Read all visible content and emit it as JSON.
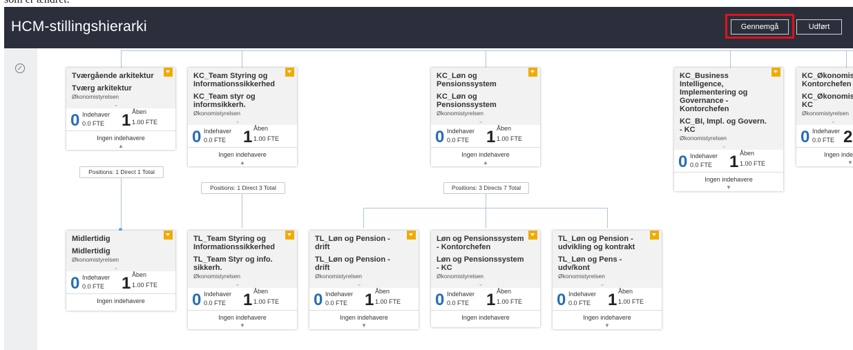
{
  "top_caption": "som er ændret.",
  "header": {
    "title": "HCM-stillingshierarki",
    "review_label": "Gennemgå",
    "done_label": "Udført"
  },
  "colors": {
    "header_bg": "#2b2f3c",
    "highlight": "#e01219",
    "flag": "#f0ab00",
    "accent_blue": "#2a6db5"
  },
  "cards": [
    {
      "t1": "Tværgående arkitektur",
      "t2": "Tværg arkitektur",
      "org": "Økonomistyrelsen",
      "holder_num": "0",
      "holder_label": "Indehaver",
      "holder_fte": "0.0 FTE",
      "open_num": "1",
      "open_label": "Åben",
      "open_fte": "1.00 FTE",
      "footer": "Ingen indehavere"
    },
    {
      "t1": "KC_Team Styring og Informationssikkerhed",
      "t2": "KC_Team styr og informsikkerh.",
      "org": "Økonomistyrelsen",
      "holder_num": "0",
      "holder_label": "Indehaver",
      "holder_fte": "0.0 FTE",
      "open_num": "1",
      "open_label": "Åben",
      "open_fte": "1.00 FTE",
      "footer": "Ingen indehavere"
    },
    {
      "t1": "KC_Løn og Pensionssystem",
      "t2": "KC_Løn og Pensionssystem",
      "org": "Økonomistyrelsen",
      "holder_num": "0",
      "holder_label": "Indehaver",
      "holder_fte": "0.0 FTE",
      "open_num": "1",
      "open_label": "Åben",
      "open_fte": "1.00 FTE",
      "footer": "Ingen indehavere"
    },
    {
      "t1": "KC_Business Intelligence, Implementering og Governance - Kontorchefen",
      "t2": "KC_BI, Impl. og Govern. - KC",
      "org": "Økonomistyrelsen",
      "holder_num": "0",
      "holder_label": "Indehaver",
      "holder_fte": "0.0 FTE",
      "open_num": "1",
      "open_label": "Åben",
      "open_fte": "1.00 FTE",
      "footer": "Ingen indehavere"
    },
    {
      "t1": "KC_Økonomis Kontorchefen",
      "t2": "KC_Økonomis KC",
      "org": "Økonomistyrelsen",
      "holder_num": "0",
      "holder_label": "Indehaver",
      "holder_fte": "0.0 FTE",
      "open_num": "2",
      "open_label": "",
      "open_fte": "",
      "footer": "Ingen inde"
    },
    {
      "t1": "Midlertidig",
      "t2": "Midlertidig",
      "org": "Økonomistyrelsen",
      "holder_num": "0",
      "holder_label": "Indehaver",
      "holder_fte": "0.0 FTE",
      "open_num": "1",
      "open_label": "Åben",
      "open_fte": "1.00 FTE",
      "footer": "Ingen indehavere"
    },
    {
      "t1": "TL_Team Styring og Informationssikkerhed",
      "t2": "TL_Team Styr og info. sikkerh.",
      "org": "Økonomistyrelsen",
      "holder_num": "0",
      "holder_label": "Indehaver",
      "holder_fte": "0.0 FTE",
      "open_num": "1",
      "open_label": "Åben",
      "open_fte": "1.00 FTE",
      "footer": "Ingen indehavere"
    },
    {
      "t1": "TL_Løn og Pension - drift",
      "t2": "TL_Løn og Pension - drift",
      "org": "Økonomistyrelsen",
      "holder_num": "0",
      "holder_label": "Indehaver",
      "holder_fte": "0.0 FTE",
      "open_num": "1",
      "open_label": "Åben",
      "open_fte": "1.00 FTE",
      "footer": "Ingen indehavere"
    },
    {
      "t1": "Løn og Pensionssystem - Kontorchefen",
      "t2": "Løn og Pensionssystem - KC",
      "org": "Økonomistyrelsen",
      "holder_num": "0",
      "holder_label": "Indehaver",
      "holder_fte": "0.0 FTE",
      "open_num": "1",
      "open_label": "Åben",
      "open_fte": "1.00 FTE",
      "footer": "Ingen indehavere"
    },
    {
      "t1": "TL_Løn og Pension - udvikling og kontrakt",
      "t2": "TL_Løn og Pens - udv/kont",
      "org": "Økonomistyrelsen",
      "holder_num": "0",
      "holder_label": "Indehaver",
      "holder_fte": "0.0 FTE",
      "open_num": "1",
      "open_label": "Åben",
      "open_fte": "1.00 FTE",
      "footer": "Ingen indehavere"
    }
  ],
  "positions": [
    "Positions: 1 Direct 1 Total",
    "Positions: 1 Direct 3 Total",
    "Positions: 3 Directs 7 Total"
  ]
}
